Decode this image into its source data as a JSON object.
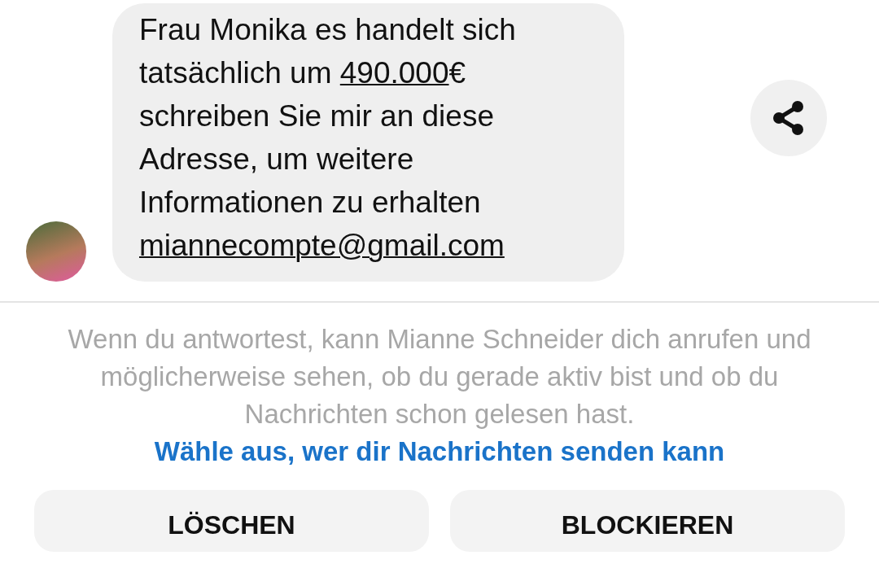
{
  "message": {
    "segments": [
      {
        "kind": "text",
        "text": "Frau Monika es handelt sich tatsächlich um "
      },
      {
        "kind": "link",
        "text": "490.000"
      },
      {
        "kind": "text",
        "text": "€ schreiben Sie mir an diese Adresse, um weitere Informationen zu erhalten "
      },
      {
        "kind": "link",
        "text": "miannecompte@gmail.com"
      }
    ]
  },
  "notice": {
    "text": "Wenn du antwortest, kann Mianne Schneider dich anrufen und möglicherweise sehen, ob du gerade aktiv bist und ob du Nachrichten schon gelesen hast.",
    "link": "Wähle aus, wer dir Nachrichten senden kann"
  },
  "buttons": [
    {
      "label": "LÖSCHEN"
    },
    {
      "label": "BLOCKIEREN"
    }
  ]
}
